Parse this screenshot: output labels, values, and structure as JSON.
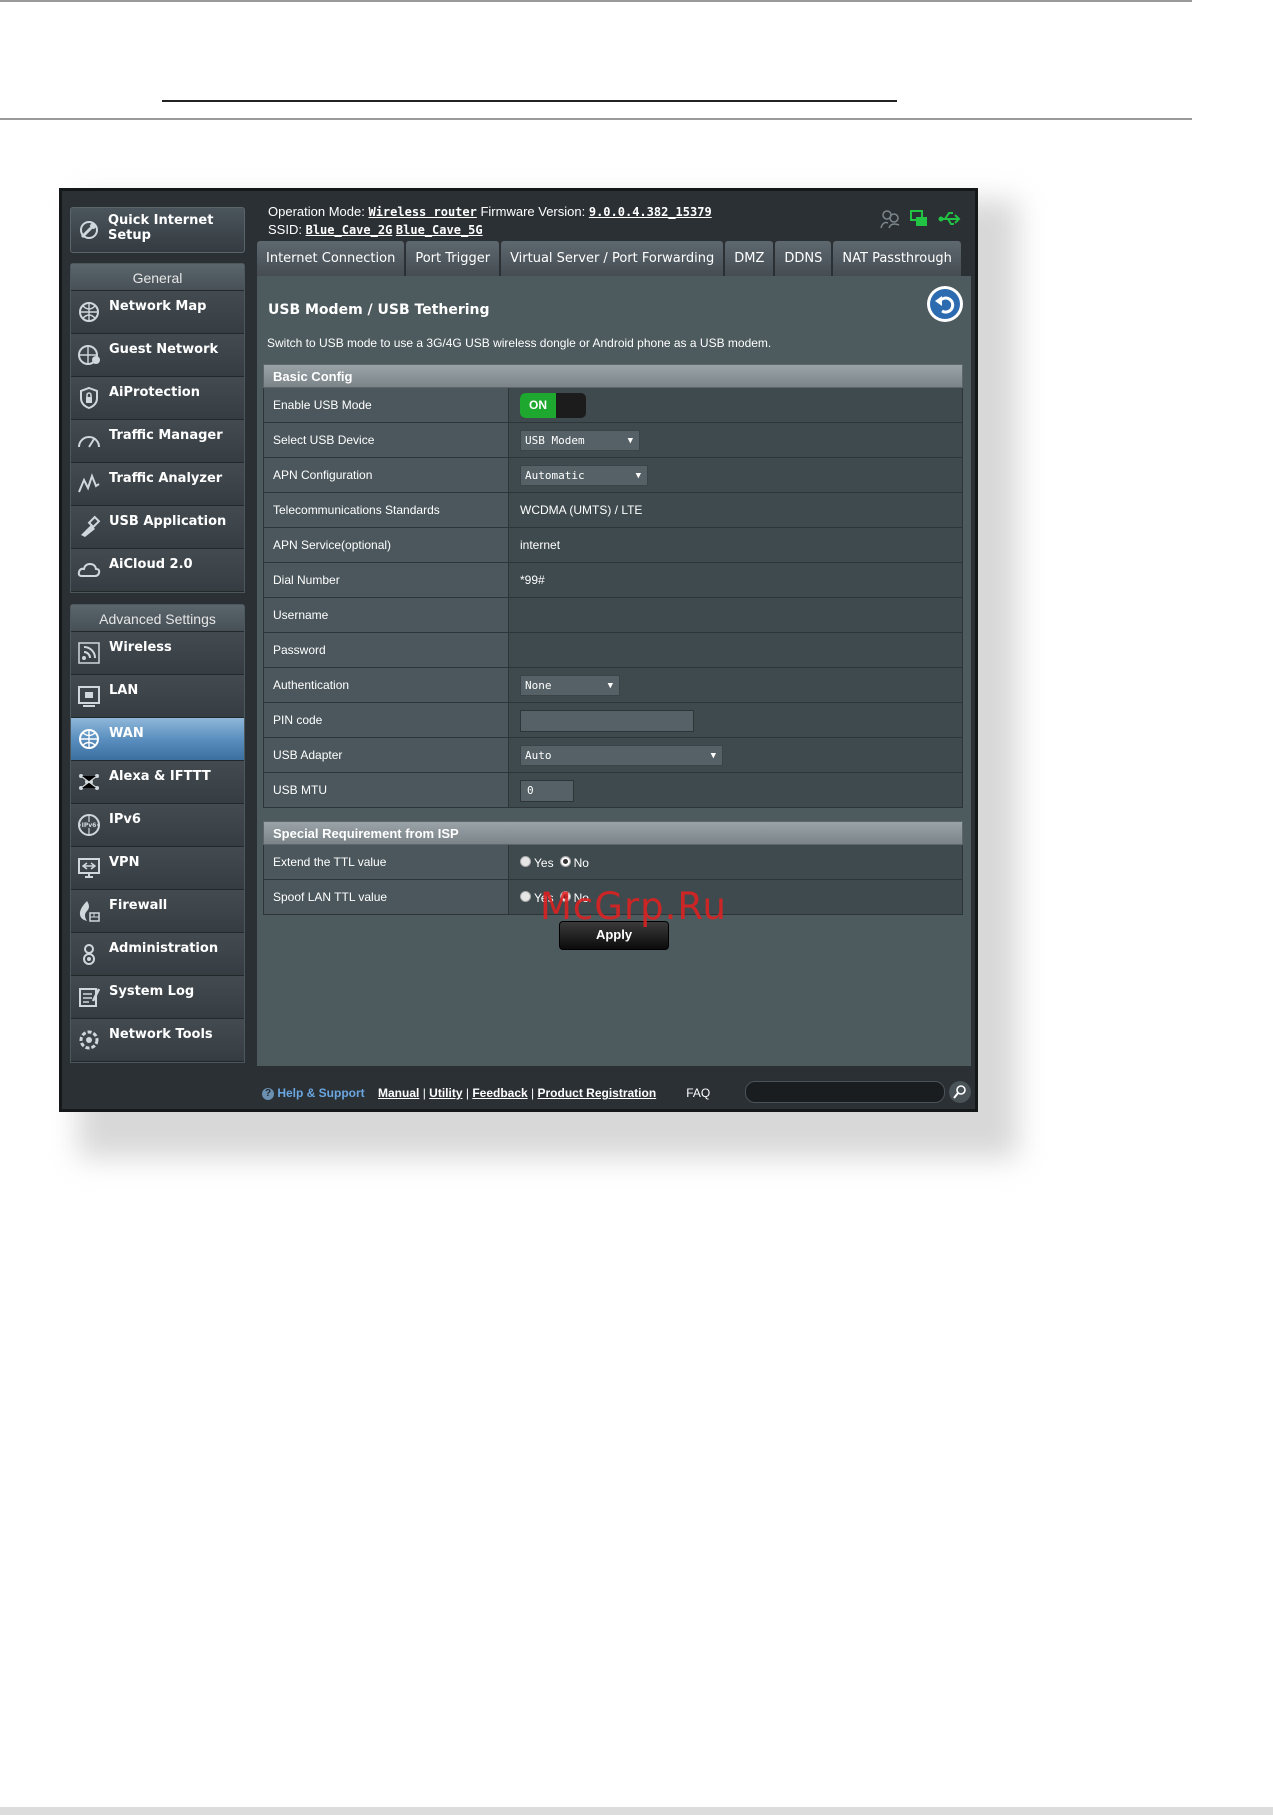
{
  "status": {
    "operation_mode_label": "Operation Mode:",
    "operation_mode": "Wireless router",
    "firmware_label": "Firmware Version:",
    "firmware": "9.0.0.4.382_15379",
    "ssid_label": "SSID:",
    "ssid_2g": "Blue_Cave_2G",
    "ssid_5g": "Blue_Cave_5G"
  },
  "sidebar": {
    "qis": "Quick Internet Setup",
    "general_header": "General",
    "general": [
      {
        "label": "Network Map",
        "icon": "network-map-icon"
      },
      {
        "label": "Guest Network",
        "icon": "guest-network-icon"
      },
      {
        "label": "AiProtection",
        "icon": "aiprotection-lock-icon"
      },
      {
        "label": "Traffic Manager",
        "icon": "traffic-manager-gauge-icon"
      },
      {
        "label": "Traffic Analyzer",
        "icon": "traffic-analyzer-icon"
      },
      {
        "label": "USB Application",
        "icon": "usb-application-icon"
      },
      {
        "label": "AiCloud 2.0",
        "icon": "aicloud-icon"
      }
    ],
    "advanced_header": "Advanced Settings",
    "advanced": [
      {
        "label": "Wireless",
        "icon": "wireless-icon"
      },
      {
        "label": "LAN",
        "icon": "lan-icon"
      },
      {
        "label": "WAN",
        "icon": "wan-globe-icon",
        "active": true
      },
      {
        "label": "Alexa & IFTTT",
        "icon": "alexa-ifttt-icon"
      },
      {
        "label": "IPv6",
        "icon": "ipv6-icon"
      },
      {
        "label": "VPN",
        "icon": "vpn-icon"
      },
      {
        "label": "Firewall",
        "icon": "firewall-icon"
      },
      {
        "label": "Administration",
        "icon": "administration-icon"
      },
      {
        "label": "System Log",
        "icon": "system-log-icon"
      },
      {
        "label": "Network Tools",
        "icon": "network-tools-icon"
      }
    ]
  },
  "tabs": [
    "Internet Connection",
    "Port Trigger",
    "Virtual Server / Port Forwarding",
    "DMZ",
    "DDNS",
    "NAT Passthrough"
  ],
  "page": {
    "title": "USB Modem / USB Tethering",
    "description": "Switch to USB mode to use a 3G/4G USB wireless dongle or Android phone as a USB modem."
  },
  "basic_config": {
    "header": "Basic Config",
    "enable_usb_mode": {
      "label": "Enable USB Mode",
      "value": "ON"
    },
    "select_usb_device": {
      "label": "Select USB Device",
      "value": "USB Modem"
    },
    "apn_configuration": {
      "label": "APN Configuration",
      "value": "Automatic"
    },
    "telecom_standards": {
      "label": "Telecommunications Standards",
      "value": "WCDMA (UMTS) / LTE"
    },
    "apn_service": {
      "label": "APN Service(optional)",
      "value": "internet"
    },
    "dial_number": {
      "label": "Dial Number",
      "value": "*99#"
    },
    "username": {
      "label": "Username",
      "value": ""
    },
    "password": {
      "label": "Password",
      "value": ""
    },
    "authentication": {
      "label": "Authentication",
      "value": "None"
    },
    "pin_code": {
      "label": "PIN code",
      "value": ""
    },
    "usb_adapter": {
      "label": "USB Adapter",
      "value": "Auto"
    },
    "usb_mtu": {
      "label": "USB MTU",
      "value": "0"
    }
  },
  "isp": {
    "header": "Special Requirement from ISP",
    "extend_ttl": {
      "label": "Extend the TTL value",
      "yes": "Yes",
      "no": "No",
      "selected": "No"
    },
    "spoof_ttl": {
      "label": "Spoof LAN TTL value",
      "yes": "Yes",
      "no": "No",
      "selected": "No"
    }
  },
  "apply_label": "Apply",
  "footer": {
    "help": "Help & Support",
    "manual": "Manual",
    "utility": "Utility",
    "feedback": "Feedback",
    "product_registration": "Product Registration",
    "sep": "|",
    "faq": "FAQ"
  },
  "watermark": "McGrp.Ru"
}
